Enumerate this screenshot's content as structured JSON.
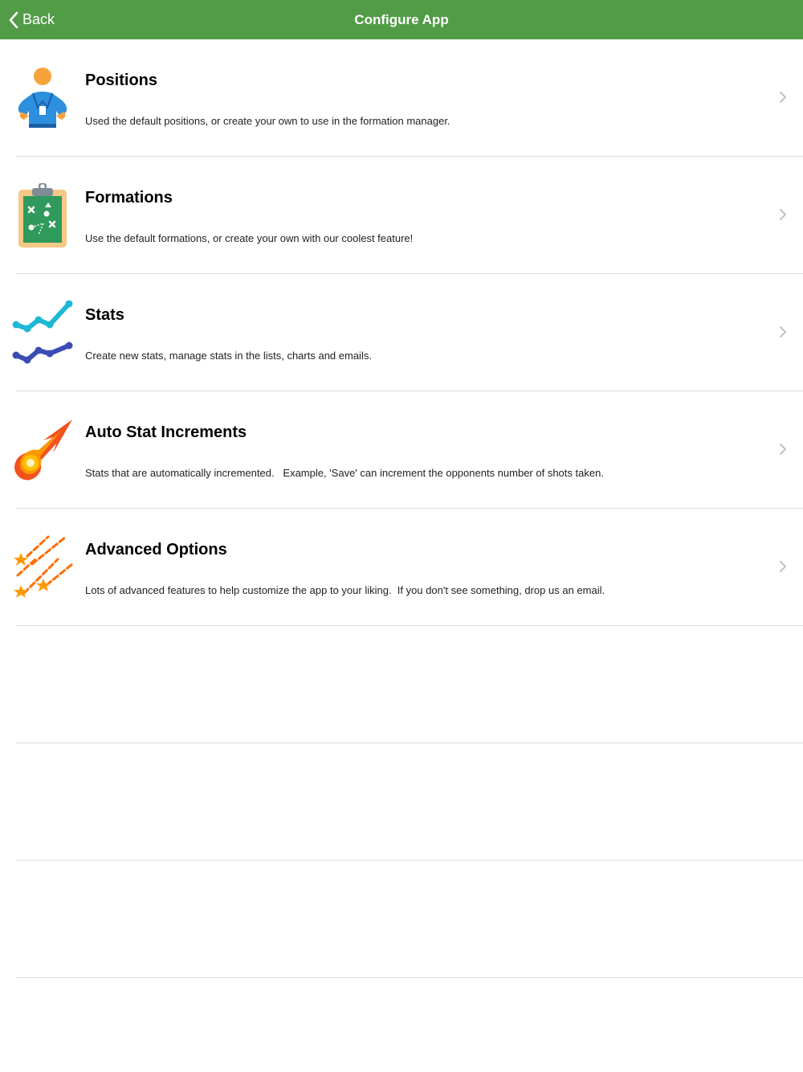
{
  "navbar": {
    "back_label": "Back",
    "title": "Configure App",
    "color": "#529c47"
  },
  "items": [
    {
      "title": "Positions",
      "description": "Used the default positions, or create your own to use in the formation manager.",
      "icon": "coach-person-icon"
    },
    {
      "title": "Formations",
      "description": "Use the default formations, or create your own with our coolest feature!",
      "icon": "clipboard-tactics-icon"
    },
    {
      "title": "Stats",
      "description": "Create new stats, manage stats in the lists, charts and emails.",
      "icon": "line-chart-icon"
    },
    {
      "title": "Auto Stat Increments",
      "description": "Stats that are automatically incremented.   Example, 'Save' can increment the opponents number of shots taken.",
      "icon": "comet-icon"
    },
    {
      "title": "Advanced Options",
      "description": "Lots of advanced features to help customize the app to your liking.  If you don't see something, drop us an email.",
      "icon": "shooting-stars-icon"
    }
  ]
}
